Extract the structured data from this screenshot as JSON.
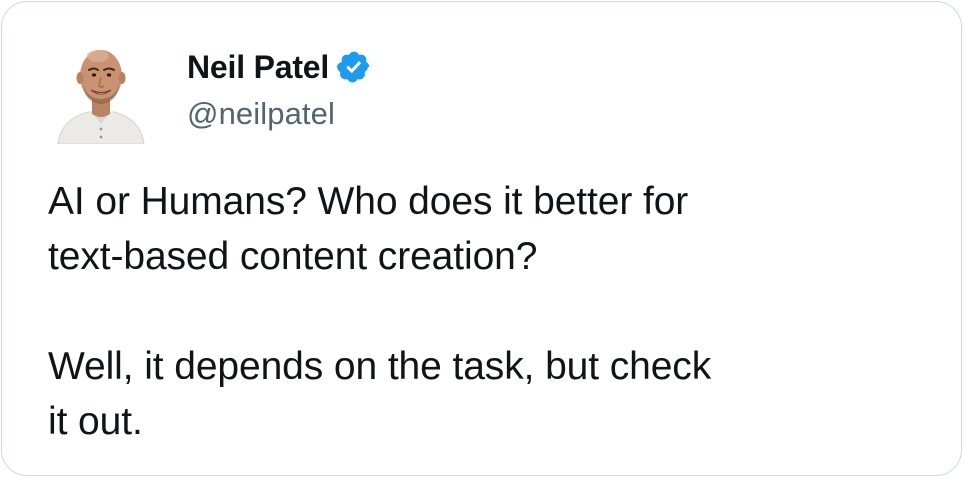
{
  "author": {
    "display_name": "Neil Patel",
    "handle": "@neilpatel",
    "verified": true,
    "verified_badge_color": "#1d9bf0"
  },
  "tweet": {
    "paragraphs": [
      {
        "lines": [
          "AI or Humans? Who does it better for",
          "text-based content creation?"
        ]
      },
      {
        "lines": [
          "Well, it depends on the task, but check",
          "it out."
        ]
      }
    ]
  },
  "icons": {
    "avatar": "profile-photo",
    "verified": "verified-checkmark-badge-icon"
  },
  "colors": {
    "text_primary": "#0f1419",
    "text_secondary": "#536471",
    "card_border": "#cfd9de"
  }
}
